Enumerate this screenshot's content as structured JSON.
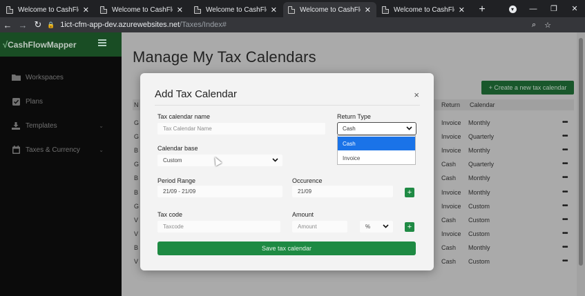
{
  "browser": {
    "tabs": [
      {
        "title": "Welcome to CashFlowMap",
        "active": false
      },
      {
        "title": "Welcome to CashFlowMap",
        "active": false
      },
      {
        "title": "Welcome to CashFlowMap",
        "active": false
      },
      {
        "title": "Welcome to CashFlowMap",
        "active": true
      },
      {
        "title": "Welcome to CashFlowMap",
        "active": false
      }
    ],
    "url_host": "1ict-cfm-app-dev.azurewebsites.net",
    "url_path": "/Taxes/Index#"
  },
  "sidebar": {
    "brand_mark": "√",
    "brand_name": "CashFlowMapper",
    "items": [
      {
        "label": "Workspaces",
        "icon": "folder-icon",
        "has_chevron": false
      },
      {
        "label": "Plans",
        "icon": "checkbox-icon",
        "has_chevron": false
      },
      {
        "label": "Templates",
        "icon": "download-icon",
        "has_chevron": true
      },
      {
        "label": "Taxes & Currency",
        "icon": "calendar-icon",
        "has_chevron": true
      }
    ]
  },
  "page": {
    "title": "Manage My Tax Calendars",
    "create_button": "+ Create a new tax calendar",
    "columns": {
      "first": "N",
      "return": "Return",
      "calendar": "Calendar"
    },
    "rows": [
      {
        "lead": "G",
        "return": "Invoice",
        "calendar": "Monthly"
      },
      {
        "lead": "G",
        "return": "Invoice",
        "calendar": "Quarterly"
      },
      {
        "lead": "B",
        "return": "Invoice",
        "calendar": "Monthly"
      },
      {
        "lead": "G",
        "return": "Cash",
        "calendar": "Quarterly"
      },
      {
        "lead": "B",
        "return": "Cash",
        "calendar": "Monthly"
      },
      {
        "lead": "B",
        "return": "Invoice",
        "calendar": "Monthly"
      },
      {
        "lead": "G",
        "return": "Invoice",
        "calendar": "Custom"
      },
      {
        "lead": "V",
        "return": "Cash",
        "calendar": "Custom"
      },
      {
        "lead": "V",
        "return": "Invoice",
        "calendar": "Custom"
      },
      {
        "lead": "B",
        "return": "Cash",
        "calendar": "Monthly"
      },
      {
        "lead": "V",
        "return": "Cash",
        "calendar": "Custom"
      }
    ],
    "row_actions": "•••"
  },
  "modal": {
    "title": "Add Tax Calendar",
    "close": "×",
    "tax_calendar_name": {
      "label": "Tax calendar name",
      "placeholder": "Tax Calendar Name"
    },
    "return_type": {
      "label": "Return Type",
      "value": "Cash",
      "options": [
        "Cash",
        "Invoice"
      ],
      "highlighted": "Cash"
    },
    "calendar_base": {
      "label": "Calendar base",
      "value": "Custom"
    },
    "period_range": {
      "label": "Period Range",
      "value": "21/09 - 21/09"
    },
    "occurence": {
      "label": "Occurence",
      "value": "21/09"
    },
    "tax_code": {
      "label": "Tax code",
      "placeholder": "Taxcode"
    },
    "amount": {
      "label": "Amount",
      "placeholder": "Amount",
      "unit": "%"
    },
    "add_symbol": "+",
    "save_button": "Save tax calendar"
  },
  "colors": {
    "brand_green": "#1f5f2c",
    "button_green": "#1e8a43",
    "select_highlight": "#1a73e8"
  }
}
